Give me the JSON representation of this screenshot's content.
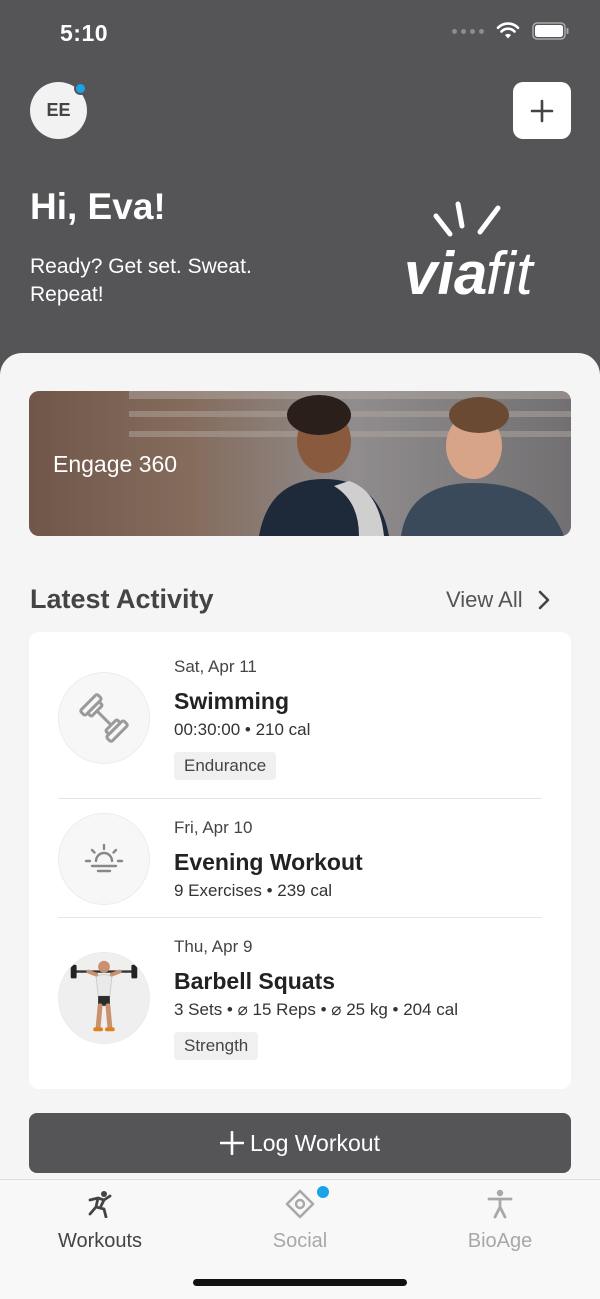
{
  "status_bar": {
    "time": "5:10"
  },
  "header": {
    "avatar_initials": "EE",
    "greeting": "Hi, Eva!",
    "tagline": "Ready? Get set. Sweat. Repeat!",
    "logo_text": "viafit"
  },
  "banner": {
    "label": "Engage 360"
  },
  "latest_activity": {
    "title": "Latest Activity",
    "view_all_label": "View All",
    "items": [
      {
        "date": "Sat, Apr 11",
        "title": "Swimming",
        "meta": "00:30:00 • 210 cal",
        "tag": "Endurance",
        "icon": "dumbbell-icon"
      },
      {
        "date": "Fri, Apr 10",
        "title": "Evening Workout",
        "meta": "9 Exercises • 239 cal",
        "tag": "",
        "icon": "sunset-icon"
      },
      {
        "date": "Thu, Apr 9",
        "title": "Barbell Squats",
        "meta": "3 Sets • ⌀ 15 Reps • ⌀ 25 kg • 204 cal",
        "tag": "Strength",
        "icon": "barbell-squat-figure"
      }
    ]
  },
  "log_workout_label": "Log Workout",
  "tabs": [
    {
      "label": "Workouts",
      "icon": "running-figure-icon",
      "active": true
    },
    {
      "label": "Social",
      "icon": "social-icon",
      "active": false
    },
    {
      "label": "BioAge",
      "icon": "person-icon",
      "active": false
    }
  ],
  "colors": {
    "header_bg": "#555557",
    "accent_dot": "#1aa3e8",
    "button_bg": "#555557"
  }
}
